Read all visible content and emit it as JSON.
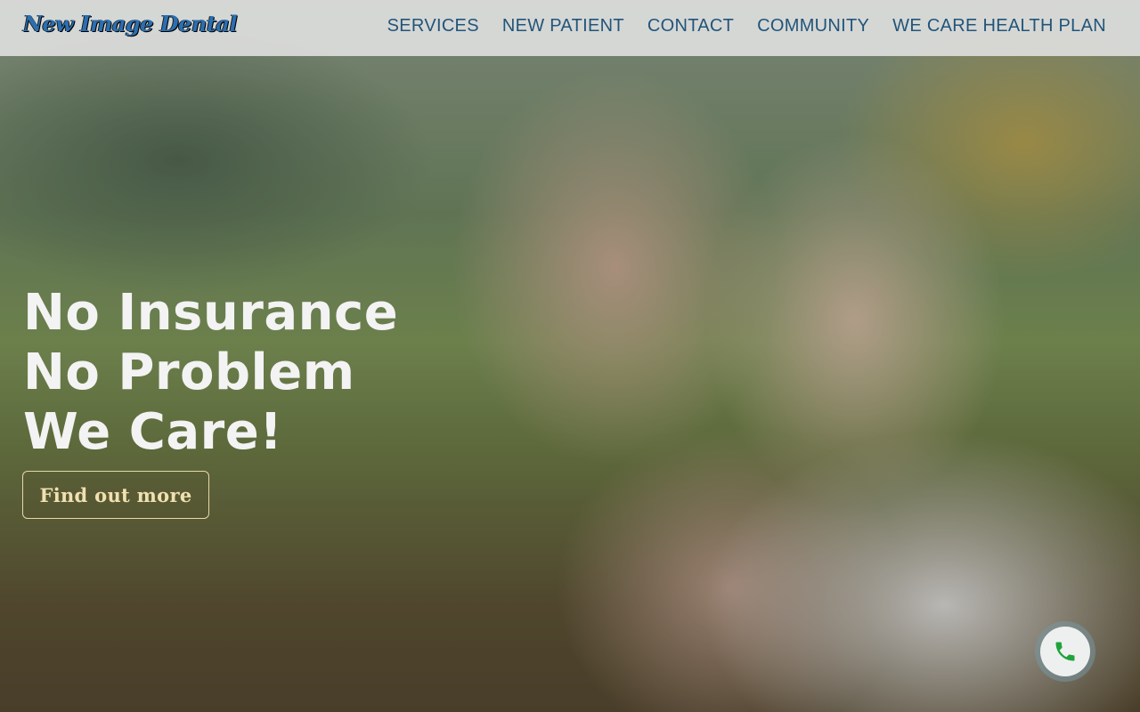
{
  "header": {
    "logo_text": "New Image Dental",
    "nav": [
      {
        "label": "SERVICES"
      },
      {
        "label": "NEW PATIENT"
      },
      {
        "label": "CONTACT"
      },
      {
        "label": "COMMUNITY"
      },
      {
        "label": "WE CARE HEALTH PLAN"
      }
    ]
  },
  "hero": {
    "title_lines": [
      "No Insurance",
      "No Problem",
      "We Care!"
    ],
    "cta_label": "Find out more",
    "image": "smiling-senior-couple-outdoors"
  },
  "floating": {
    "phone_icon": "phone-icon",
    "phone_icon_color": "#1fa33a"
  },
  "colors": {
    "nav_text": "#22557a",
    "header_bg": "#e2e2e2",
    "hero_text": "#f3f3f3",
    "cta_text": "#f1e0b0"
  }
}
